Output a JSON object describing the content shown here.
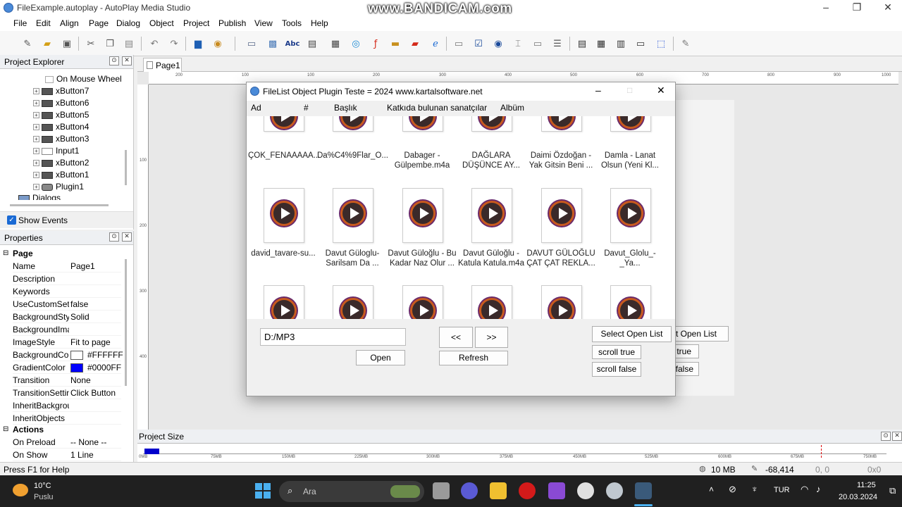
{
  "app": {
    "title": "FileExample.autoplay - AutoPlay Media Studio",
    "watermark": "www.BANDICAM.com"
  },
  "menu": [
    "File",
    "Edit",
    "Align",
    "Page",
    "Dialog",
    "Object",
    "Project",
    "Publish",
    "View",
    "Tools",
    "Help"
  ],
  "explorer": {
    "title": "Project Explorer",
    "items": [
      "On Mouse Wheel",
      "xButton7",
      "xButton6",
      "xButton5",
      "xButton4",
      "xButton3",
      "Input1",
      "xButton2",
      "xButton1",
      "Plugin1",
      "Dialogs"
    ],
    "show_events": "Show Events"
  },
  "properties": {
    "title": "Properties",
    "section_page": "Page",
    "rows": [
      {
        "name": "Name",
        "value": "Page1"
      },
      {
        "name": "Description",
        "value": ""
      },
      {
        "name": "Keywords",
        "value": ""
      },
      {
        "name": "UseCustomSett",
        "value": "false"
      },
      {
        "name": "BackgroundStyl",
        "value": "Solid"
      },
      {
        "name": "BackgroundIma",
        "value": ""
      },
      {
        "name": "ImageStyle",
        "value": "Fit to page"
      },
      {
        "name": "BackgroundCol",
        "value": "#FFFFFF"
      },
      {
        "name": "GradientColor",
        "value": "#0000FF"
      },
      {
        "name": "Transition",
        "value": "None"
      },
      {
        "name": "TransitionSettin",
        "value": "Click Button"
      },
      {
        "name": "InheritBackgrou",
        "value": ""
      },
      {
        "name": "InheritObjects",
        "value": ""
      }
    ],
    "section_actions": "Actions",
    "actions": [
      {
        "name": "On Preload",
        "value": "-- None --"
      },
      {
        "name": "On Show",
        "value": "1 Line"
      }
    ],
    "colors": {
      "background": "#FFFFFF",
      "gradient": "#0000FF"
    }
  },
  "doc_tab": "Page1",
  "ruler": {
    "h": [
      "200",
      "100",
      "100",
      "200",
      "300",
      "400",
      "500",
      "600",
      "700",
      "800",
      "900",
      "1000"
    ],
    "v": [
      "100",
      "200",
      "300",
      "400"
    ]
  },
  "dialog": {
    "title": "FileList Object Plugin Teste = 2024 www.kartalsoftware.net",
    "columns": [
      "Ad",
      "#",
      "Başlık",
      "Katkıda bulunan sanatçılar",
      "Albüm"
    ],
    "files_row1": [
      [
        "ÇOK_FENAAAAA...",
        ""
      ],
      [
        "Da%C4%9Flar_O...",
        ""
      ],
      [
        "Dabager -",
        "Gülpembe.m4a"
      ],
      [
        "DAĞLARA",
        "DÜŞÜNCE AY..."
      ],
      [
        "Daimi Özdoğan -",
        "Yak Gitsin Beni ..."
      ],
      [
        "Damla - Lanat",
        "Olsun (Yeni Kl..."
      ]
    ],
    "files_row2": [
      [
        "david_tavare-su...",
        ""
      ],
      [
        "Davut Güloglu-",
        "Sarilsam Da ..."
      ],
      [
        "Davut Güloğlu - Bu",
        "Kadar Naz Olur ..."
      ],
      [
        "Davut Güloğlu -",
        "Katula Katula.m4a"
      ],
      [
        "DAVUT GÜLOĞLU",
        "ÇAT ÇAT REKLA..."
      ],
      [
        "Davut_Glolu_-_Ya...",
        ""
      ]
    ],
    "path_value": "D:/MP3",
    "btn_open": "Open",
    "btn_prev": "<<",
    "btn_next": ">>",
    "btn_refresh": "Refresh",
    "btn_select_open_list": "Select Open List",
    "btn_scroll_true": "scroll true",
    "btn_scroll_false": "scroll false"
  },
  "behind": {
    "select": "ct Open List",
    "true": "true",
    "false": "false"
  },
  "project_size": {
    "title": "Project Size",
    "ticks": [
      "0MB",
      "75MB",
      "150MB",
      "225MB",
      "300MB",
      "375MB",
      "450MB",
      "525MB",
      "600MB",
      "675MB",
      "750MB"
    ],
    "fill_fraction": 0.02
  },
  "status": {
    "help": "Press F1 for Help",
    "size": "10 MB",
    "coords": "-68,414",
    "pos": "0, 0",
    "dim": "0x0"
  },
  "taskbar": {
    "weather_temp": "10°C",
    "weather_desc": "Puslu",
    "search": "Ara",
    "lang": "TUR",
    "time": "11:25",
    "date": "20.03.2024"
  }
}
